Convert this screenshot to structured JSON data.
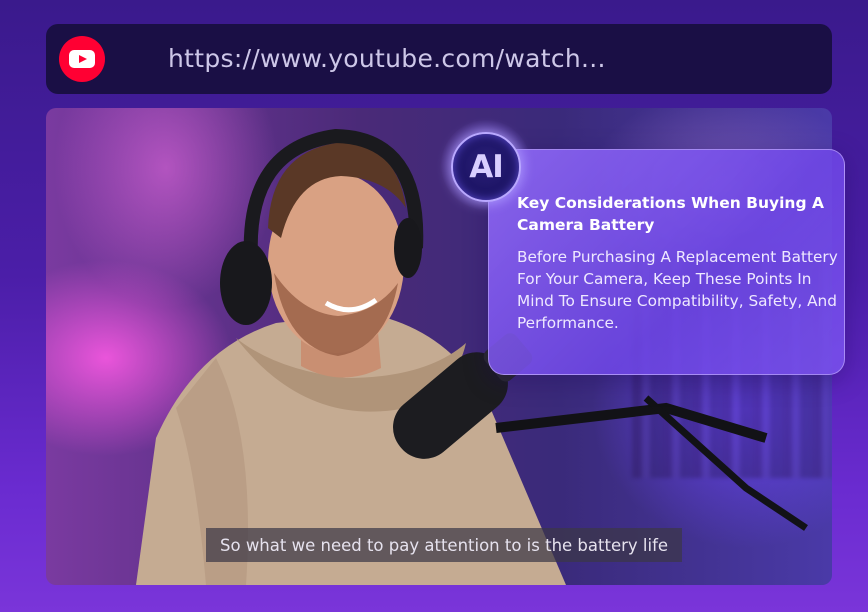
{
  "address_bar": {
    "url": "https://www.youtube.com/watch...",
    "site_icon": "youtube-icon",
    "accent_color": "#ff0033"
  },
  "video": {
    "subtitle": "So what we need to pay attention to is the battery life",
    "scene": "podcast-host-with-headphones-and-microphone"
  },
  "ai_summary": {
    "badge": "AI",
    "title": "Key Considerations When Buying A Camera Battery",
    "body": "Before Purchasing A Replacement Battery For Your Camera, Keep These Points In Mind To Ensure Compatibility, Safety, And Performance."
  },
  "colors": {
    "background": "#4b1ea8",
    "card": "#8a5cf0",
    "address_bar": "#1a0f45"
  }
}
